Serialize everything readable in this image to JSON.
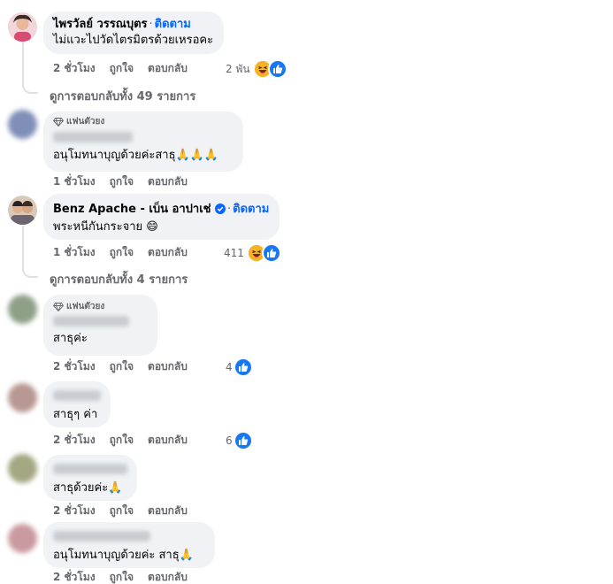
{
  "comments": [
    {
      "name": "ไพรวัลย์ วรรณบุตร",
      "follow": "ติดตาม",
      "text": "ไม่แวะไปวัดไตรมิตรด้วยเหรอคะ",
      "time": "2 ชั่วโมง",
      "like": "ถูกใจ",
      "reply": "ตอบกลับ",
      "reaction_count": "2 พัน",
      "reactions": [
        "haha",
        "like"
      ],
      "replies_link": "ดูการตอบกลับทั้ง 49 รายการ"
    },
    {
      "badge": "แฟนตัวยง",
      "text": "อนุโมทนาบุญด้วยค่ะสาธุ🙏🙏🙏",
      "time": "1 ชั่วโมง",
      "like": "ถูกใจ",
      "reply": "ตอบกลับ"
    },
    {
      "name": "Benz Apache - เบ็น อาปาเช่",
      "follow": "ติดตาม",
      "text": "พระหนีกันกระจาย 😄",
      "time": "1 ชั่วโมง",
      "like": "ถูกใจ",
      "reply": "ตอบกลับ",
      "reaction_count": "411",
      "reactions": [
        "haha",
        "like"
      ],
      "replies_link": "ดูการตอบกลับทั้ง 4 รายการ"
    },
    {
      "badge": "แฟนตัวยง",
      "text": "สาธุค่ะ",
      "time": "2 ชั่วโมง",
      "like": "ถูกใจ",
      "reply": "ตอบกลับ",
      "reaction_count": "4",
      "reactions": [
        "like"
      ]
    },
    {
      "text": "สาธุๆ ค่า",
      "time": "2 ชั่วโมง",
      "like": "ถูกใจ",
      "reply": "ตอบกลับ",
      "reaction_count": "6",
      "reactions": [
        "like"
      ]
    },
    {
      "text": "สาธุด้วยค่ะ🙏",
      "time": "2 ชั่วโมง",
      "like": "ถูกใจ",
      "reply": "ตอบกลับ"
    },
    {
      "text": "อนุโมทนาบุญด้วยค่ะ สาธุ🙏",
      "time": "2 ชั่วโมง",
      "like": "ถูกใจ",
      "reply": "ตอบกลับ"
    }
  ],
  "colors": {
    "link": "#0866ff",
    "like": "#1877f2",
    "secondary": "#65676b",
    "bubble": "#f0f2f5"
  }
}
